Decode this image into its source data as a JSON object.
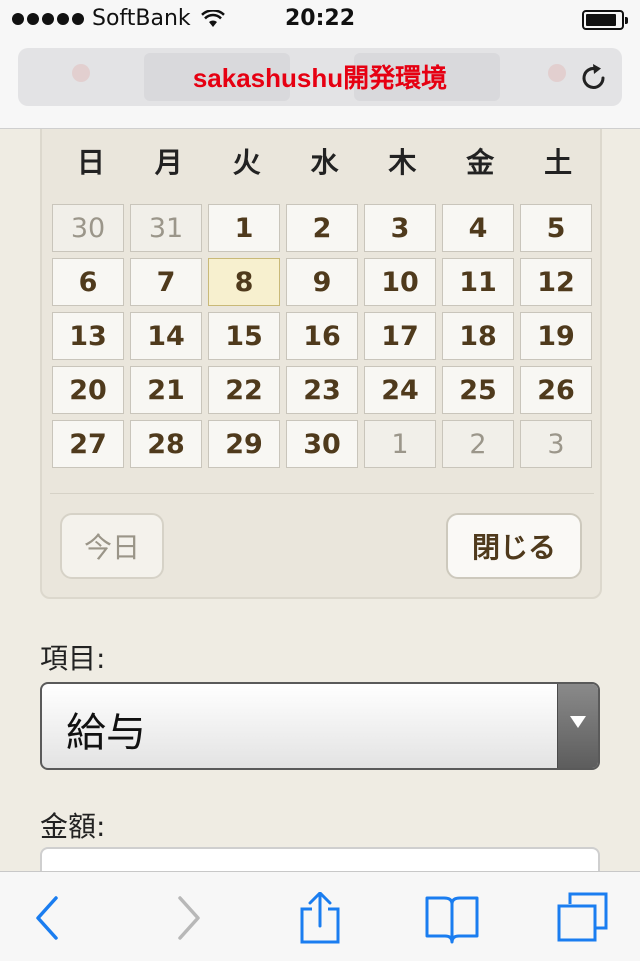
{
  "status_bar": {
    "carrier": "SoftBank",
    "time": "20:22"
  },
  "browser": {
    "page_title": "sakashushu開発環境"
  },
  "calendar": {
    "weekdays": [
      "日",
      "月",
      "火",
      "水",
      "木",
      "金",
      "土"
    ],
    "days": [
      {
        "label": "30",
        "state": "other"
      },
      {
        "label": "31",
        "state": "other"
      },
      {
        "label": "1",
        "state": "current"
      },
      {
        "label": "2",
        "state": "current"
      },
      {
        "label": "3",
        "state": "current"
      },
      {
        "label": "4",
        "state": "current"
      },
      {
        "label": "5",
        "state": "current"
      },
      {
        "label": "6",
        "state": "current"
      },
      {
        "label": "7",
        "state": "current"
      },
      {
        "label": "8",
        "state": "selected"
      },
      {
        "label": "9",
        "state": "current"
      },
      {
        "label": "10",
        "state": "current"
      },
      {
        "label": "11",
        "state": "current"
      },
      {
        "label": "12",
        "state": "current"
      },
      {
        "label": "13",
        "state": "current"
      },
      {
        "label": "14",
        "state": "current"
      },
      {
        "label": "15",
        "state": "current"
      },
      {
        "label": "16",
        "state": "current"
      },
      {
        "label": "17",
        "state": "current"
      },
      {
        "label": "18",
        "state": "current"
      },
      {
        "label": "19",
        "state": "current"
      },
      {
        "label": "20",
        "state": "current"
      },
      {
        "label": "21",
        "state": "current"
      },
      {
        "label": "22",
        "state": "current"
      },
      {
        "label": "23",
        "state": "current"
      },
      {
        "label": "24",
        "state": "current"
      },
      {
        "label": "25",
        "state": "current"
      },
      {
        "label": "26",
        "state": "current"
      },
      {
        "label": "27",
        "state": "current"
      },
      {
        "label": "28",
        "state": "current"
      },
      {
        "label": "29",
        "state": "current"
      },
      {
        "label": "30",
        "state": "current"
      },
      {
        "label": "1",
        "state": "other"
      },
      {
        "label": "2",
        "state": "other"
      },
      {
        "label": "3",
        "state": "other"
      }
    ],
    "today_button": "今日",
    "close_button": "閉じる"
  },
  "form": {
    "item_label": "項目:",
    "item_value": "給与",
    "amount_label": "金額:",
    "amount_value": ""
  },
  "toolbar": {
    "icons": [
      "back-icon",
      "forward-icon",
      "share-icon",
      "bookmarks-icon",
      "tabs-icon"
    ],
    "accent_color": "#1a7df0",
    "disabled_color": "#b8b8b8"
  },
  "colors": {
    "title_red": "#e60012",
    "day_text": "#4f3a1c",
    "page_bg": "#efece3"
  }
}
